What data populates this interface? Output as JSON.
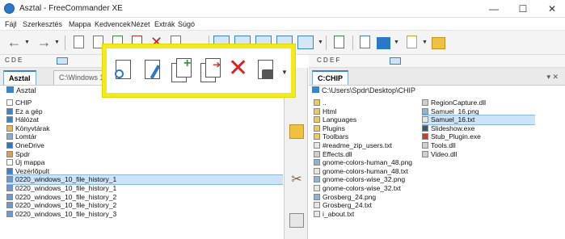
{
  "window": {
    "title": "Asztal - FreeCommander XE",
    "min": "—",
    "max": "☐",
    "close": "✕"
  },
  "menu": [
    "Fájl",
    "Szerkesztés",
    "Mappa",
    "Kedvencek",
    "Nézet",
    "Extrák",
    "Súgó"
  ],
  "left_drives": "C  D  E",
  "right_drives": "C  D  E  F",
  "left_panel": {
    "tabs": [
      "Asztal",
      "C:\\Windows 10"
    ],
    "path": "Asztal",
    "items": [
      {
        "name": "CHIP",
        "icon": "folder-icon",
        "color": "#ffffff"
      },
      {
        "name": "Ez a gép",
        "icon": "computer-icon",
        "color": "#3a84c8"
      },
      {
        "name": "Hálózat",
        "icon": "network-icon",
        "color": "#3a84c8"
      },
      {
        "name": "Könyvtárak",
        "icon": "library-icon",
        "color": "#e8b84a"
      },
      {
        "name": "Lomtár",
        "icon": "recycle-bin-icon",
        "color": "#8aa8c8"
      },
      {
        "name": "OneDrive",
        "icon": "cloud-icon",
        "color": "#2a78c8"
      },
      {
        "name": "Spdr",
        "icon": "user-icon",
        "color": "#d6a050"
      },
      {
        "name": "Új mappa",
        "icon": "folder-icon",
        "color": "#ffffff"
      },
      {
        "name": "Vezérlőpult",
        "icon": "control-panel-icon",
        "color": "#3a84c8"
      },
      {
        "name": "0220_windows_10_file_history_1",
        "icon": "file-icon",
        "color": "#6a9ad0",
        "selected": true
      },
      {
        "name": "0220_windows_10_file_history_1",
        "icon": "file-icon",
        "color": "#6a9ad0"
      },
      {
        "name": "0220_windows_10_file_history_2",
        "icon": "file-icon",
        "color": "#6a9ad0"
      },
      {
        "name": "0220_windows_10_file_history_2",
        "icon": "file-icon",
        "color": "#6a9ad0"
      },
      {
        "name": "0220_windows_10_file_history_3",
        "icon": "file-icon",
        "color": "#6a9ad0"
      }
    ]
  },
  "right_panel": {
    "tabs": [
      "C:CHIP"
    ],
    "path": "C:\\Users\\Spdr\\Desktop\\CHIP",
    "col_a": [
      {
        "name": "..",
        "icon": "folder-up-icon",
        "color": "#f0c860"
      },
      {
        "name": "Html",
        "icon": "folder-icon",
        "color": "#f0c860"
      },
      {
        "name": "Languages",
        "icon": "folder-icon",
        "color": "#f0c860"
      },
      {
        "name": "Plugins",
        "icon": "folder-icon",
        "color": "#f0c860"
      },
      {
        "name": "Toolbars",
        "icon": "folder-icon",
        "color": "#f0c860"
      },
      {
        "name": "#readme_zip_users.txt",
        "icon": "text-file-icon",
        "color": "#e6e6e6"
      },
      {
        "name": "Effects.dll",
        "icon": "dll-file-icon",
        "color": "#cfcfcf"
      },
      {
        "name": "gnome-colors-human_48.png",
        "icon": "image-file-icon",
        "color": "#8ab4d8"
      },
      {
        "name": "gnome-colors-human_48.txt",
        "icon": "text-file-icon",
        "color": "#e6e6e6"
      },
      {
        "name": "gnome-colors-wise_32.png",
        "icon": "image-file-icon",
        "color": "#8ab4d8"
      },
      {
        "name": "gnome-colors-wise_32.txt",
        "icon": "text-file-icon",
        "color": "#e6e6e6"
      },
      {
        "name": "Grosberg_24.png",
        "icon": "image-file-icon",
        "color": "#8ab4d8"
      },
      {
        "name": "Grosberg_24.txt",
        "icon": "text-file-icon",
        "color": "#e6e6e6"
      },
      {
        "name": "i_about.txt",
        "icon": "text-file-icon",
        "color": "#e6e6e6"
      }
    ],
    "col_b": [
      {
        "name": "RegionCapture.dll",
        "icon": "dll-file-icon",
        "color": "#cfcfcf"
      },
      {
        "name": "Samuel_16.png",
        "icon": "image-file-icon",
        "color": "#8ab4d8"
      },
      {
        "name": "Samuel_16.txt",
        "icon": "text-file-icon",
        "color": "#e6e6e6",
        "selected": true
      },
      {
        "name": "Slideshow.exe",
        "icon": "exe-file-icon",
        "color": "#445566"
      },
      {
        "name": "Stub_Plugin.exe",
        "icon": "exe-file-icon",
        "color": "#c04030"
      },
      {
        "name": "Tools.dll",
        "icon": "dll-file-icon",
        "color": "#cfcfcf"
      },
      {
        "name": "Video.dll",
        "icon": "dll-file-icon",
        "color": "#cfcfcf"
      }
    ]
  },
  "colors": {
    "accent": "#3a84c8",
    "highlight": "#f2ea1a",
    "delete": "#e02020"
  }
}
